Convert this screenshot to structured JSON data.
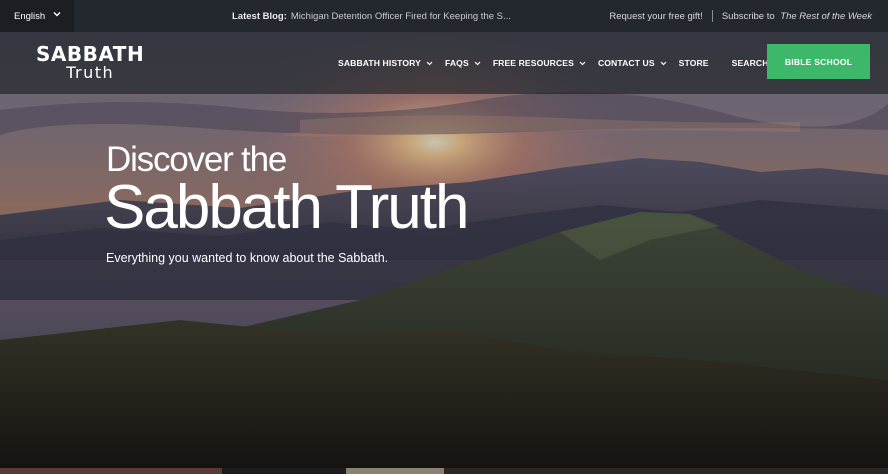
{
  "topbar": {
    "language": "English",
    "blog_label": "Latest Blog:",
    "blog_title": "Michigan Detention Officer Fired for Keeping the S...",
    "gift_link": "Request your free gift!",
    "subscribe_prefix": "Subscribe to",
    "subscribe_title": "The Rest of the Week"
  },
  "logo": {
    "line1": "SABBATH",
    "line2": "Truth"
  },
  "nav": {
    "items": [
      {
        "label": "SABBATH HISTORY"
      },
      {
        "label": "FAQS"
      },
      {
        "label": "FREE RESOURCES"
      },
      {
        "label": "CONTACT US"
      },
      {
        "label": "STORE"
      },
      {
        "label": "SEARCH"
      }
    ],
    "cta": "BIBLE SCHOOL"
  },
  "hero": {
    "pre_title": "Discover the",
    "title": "Sabbath Truth",
    "subtitle": "Everything you wanted to know about the Sabbath."
  },
  "colors": {
    "accent": "#3db76a",
    "topbar": "#23272e",
    "nav_overlay": "#1a1e24"
  },
  "icons": [
    "chevron-down-icon"
  ]
}
